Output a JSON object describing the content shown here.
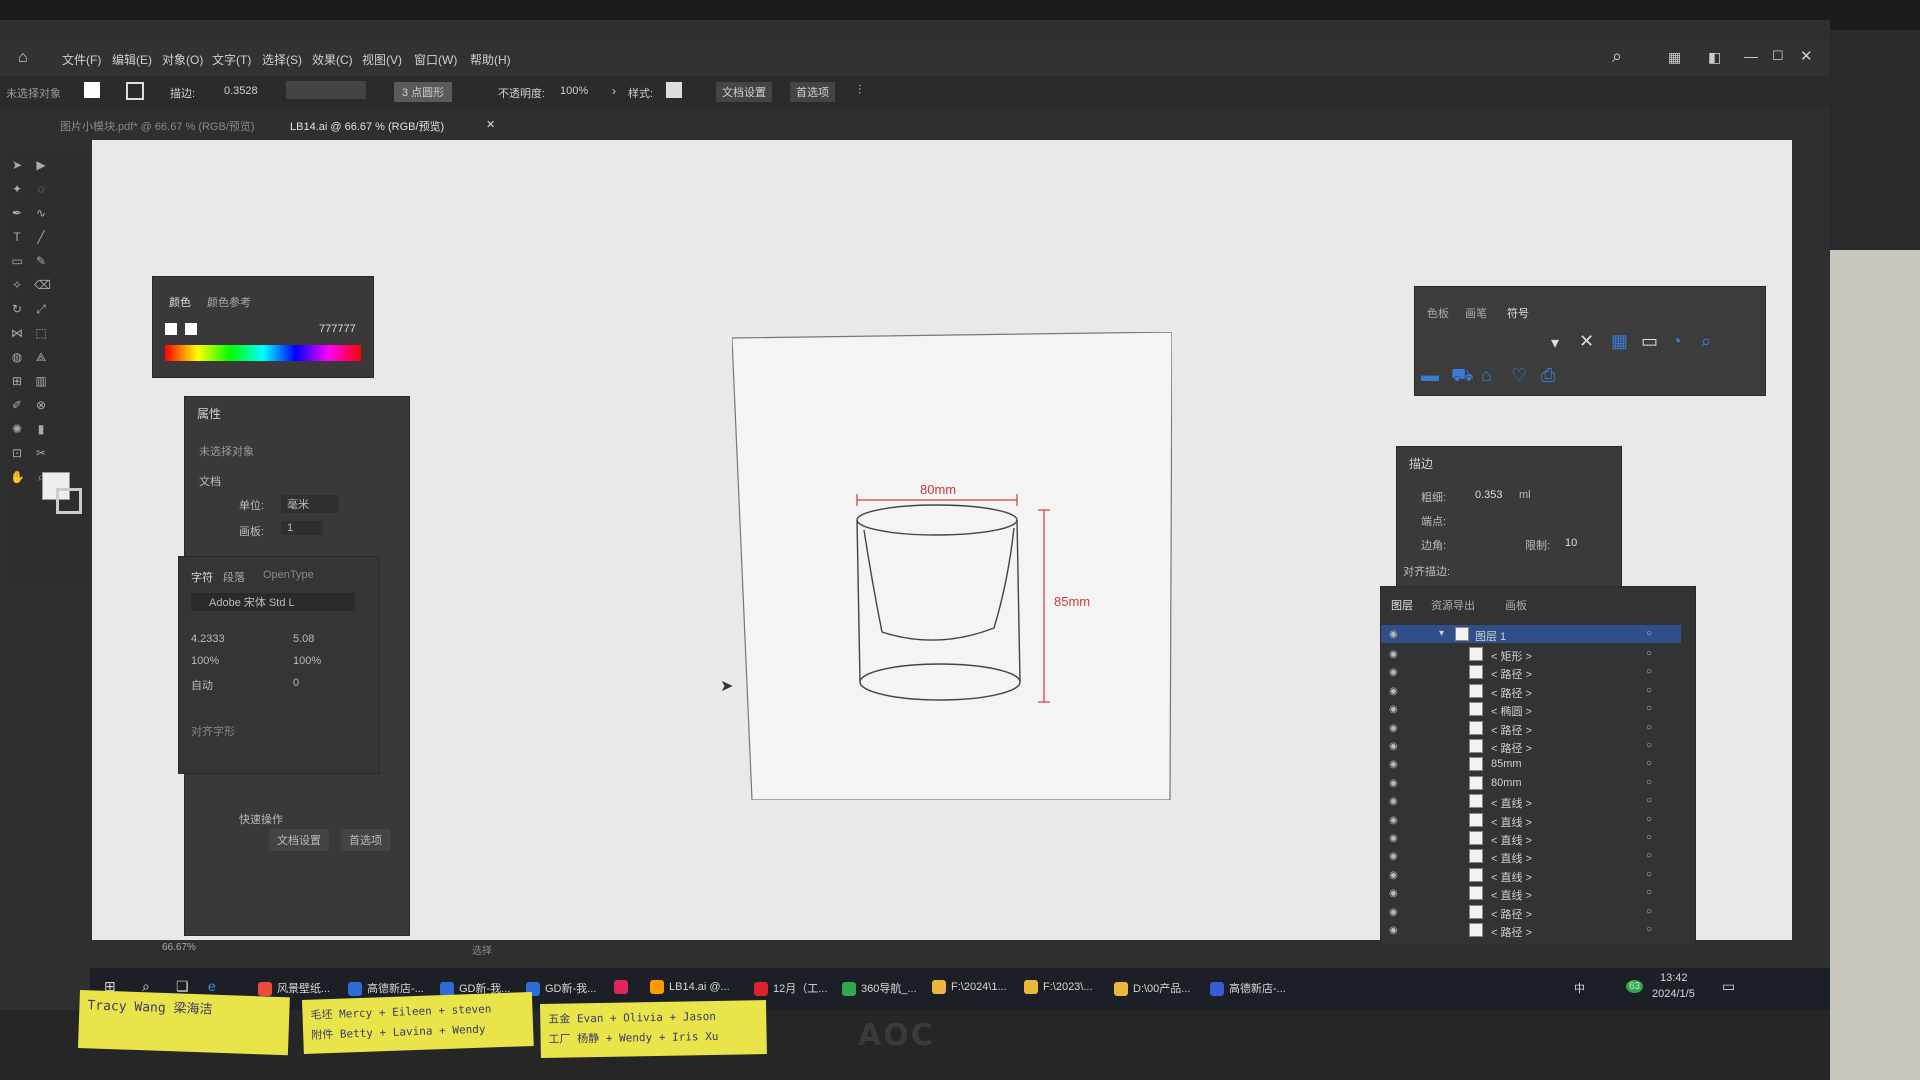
{
  "app": {
    "menus": [
      "文件(F)",
      "编辑(E)",
      "对象(O)",
      "文字(T)",
      "选择(S)",
      "效果(C)",
      "视图(V)",
      "窗口(W)",
      "帮助(H)"
    ]
  },
  "control_bar": {
    "left_label": "未选择对象",
    "stroke_label": "描边:",
    "stroke_value": "0.3528",
    "shape_value": "3 点圆形",
    "opacity_label": "不透明度:",
    "opacity_value": "100%",
    "style_label": "样式:",
    "doc_settings_button": "文档设置",
    "preferences_button": "首选项"
  },
  "tabs": [
    {
      "label": "图片小模块.pdf* @ 66.67 % (RGB/预览)",
      "active": false
    },
    {
      "label": "LB14.ai @ 66.67 % (RGB/预览)",
      "active": true
    }
  ],
  "color_panel": {
    "tab_color": "颜色",
    "tab_guide": "颜色参考",
    "hex_value": "777777"
  },
  "properties_panel": {
    "title": "属性",
    "no_selection": "未选择对象",
    "section_doc": "文档",
    "unit_label": "单位:",
    "unit_value": "毫米",
    "artboard_label": "画板:",
    "artboard_value": "1",
    "section_quick": "快速操作",
    "doc_settings_button": "文档设置",
    "preferences_button": "首选项"
  },
  "character_panel": {
    "tab_char": "字符",
    "tab_para": "段落",
    "tab_opentype": "OpenType",
    "font_value": "Adobe 宋体 Std L",
    "size_value": "4.2333",
    "leading_value": "5.08",
    "hscale_value": "100%",
    "vscale_value": "100%",
    "kerning_value": "自动",
    "tracking_value": "0",
    "snap_label": "对齐字形"
  },
  "drawing": {
    "width_label": "80mm",
    "height_label": "85mm"
  },
  "symbols_panel": {
    "tab_swatch": "色板",
    "tab_brush": "画笔",
    "tab_symbol": "符号"
  },
  "stroke_panel": {
    "title": "描边",
    "weight_label": "粗细:",
    "weight_value": "0.353",
    "weight_unit": "ml",
    "cap_label": "端点:",
    "corner_label": "边角:",
    "limit_label": "限制:",
    "limit_value": "10",
    "align_label": "对齐描边:"
  },
  "layers_panel": {
    "tab_layers": "图层",
    "tab_export": "资源导出",
    "tab_artboards": "画板",
    "layer_name": "图层 1",
    "items": [
      "< 矩形 >",
      "< 路径 >",
      "< 路径 >",
      "< 椭圆 >",
      "< 路径 >",
      "< 路径 >",
      "85mm",
      "80mm",
      "< 直线 >",
      "< 直线 >",
      "< 直线 >",
      "< 直线 >",
      "< 直线 >",
      "< 直线 >",
      "< 路径 >",
      "< 路径 >"
    ]
  },
  "status_bar": {
    "zoom": "66.67%",
    "mode": "选择"
  },
  "taskbar": {
    "items": [
      {
        "label": "风景壁纸...",
        "color": "#e94b3c"
      },
      {
        "label": "高德新店-...",
        "color": "#2b6cd6"
      },
      {
        "label": "GD新-我...",
        "color": "#2b6cd6"
      },
      {
        "label": "GD新-我...",
        "color": "#2b6cd6"
      },
      {
        "label": "",
        "color": "#e0245e"
      },
      {
        "label": "LB14.ai @...",
        "color": "#ff9a00"
      },
      {
        "label": "12月（工...",
        "color": "#d9232d"
      },
      {
        "label": "360导航_...",
        "color": "#2eaa4a"
      },
      {
        "label": "F:\\2024\\1...",
        "color": "#e8b83a"
      },
      {
        "label": "F:\\2023\\...",
        "color": "#e8b83a"
      },
      {
        "label": "D:\\00产品...",
        "color": "#e8b83a"
      },
      {
        "label": "高德新店-...",
        "color": "#3a5bd6"
      }
    ],
    "ime": "中",
    "time": "13:42",
    "date": "2024/1/5",
    "badge": "63"
  },
  "sticky_notes": [
    {
      "text": "Tracy Wang 梁海洁"
    },
    {
      "text": "毛坯 Mercy + Eileen + steven\n附件 Betty + Lavina + Wendy"
    },
    {
      "text": "五金 Evan + Olivia + Jason\n工厂 杨静 + Wendy + Iris Xu"
    }
  ],
  "monitor": {
    "brand": "AOC"
  }
}
